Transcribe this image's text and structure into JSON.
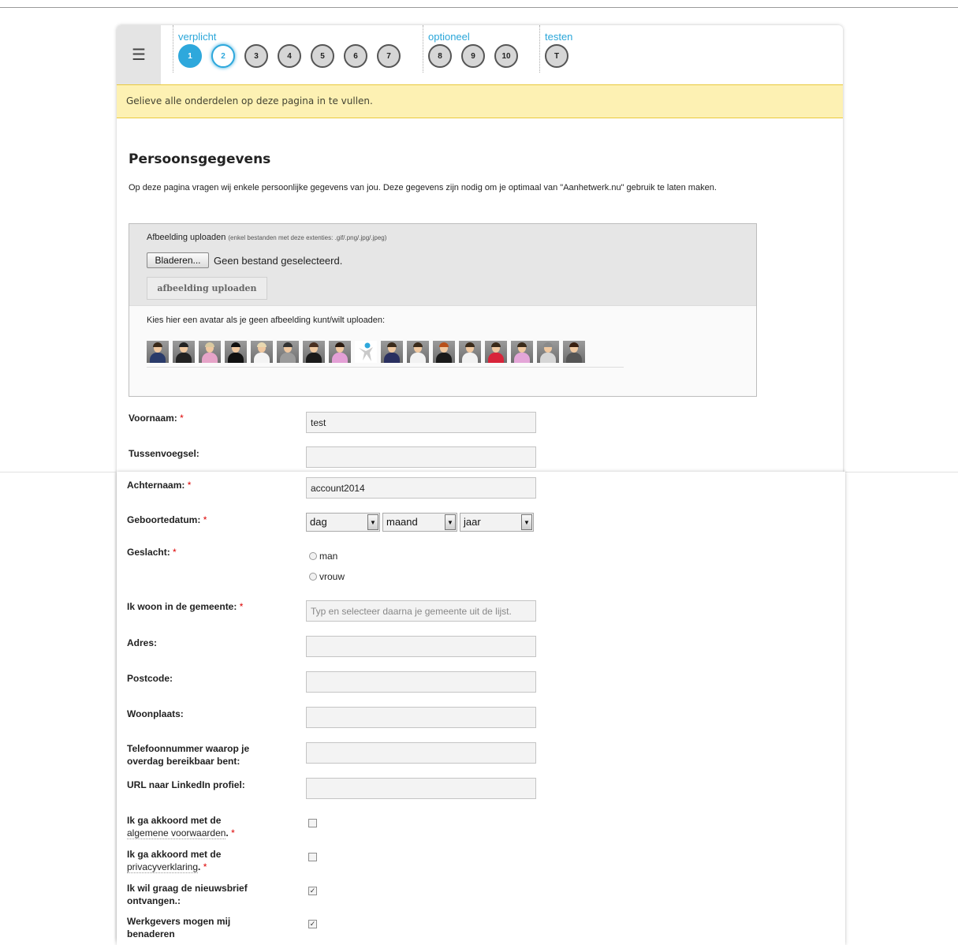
{
  "nav": {
    "menu_icon": "hamburger-menu-icon",
    "groups": [
      {
        "label": "verplicht",
        "steps": [
          {
            "label": "1",
            "state": "done"
          },
          {
            "label": "2",
            "state": "current"
          },
          {
            "label": "3",
            "state": "pending"
          },
          {
            "label": "4",
            "state": "pending"
          },
          {
            "label": "5",
            "state": "pending"
          },
          {
            "label": "6",
            "state": "pending"
          },
          {
            "label": "7",
            "state": "pending"
          }
        ]
      },
      {
        "label": "optioneel",
        "steps": [
          {
            "label": "8",
            "state": "pending"
          },
          {
            "label": "9",
            "state": "pending"
          },
          {
            "label": "10",
            "state": "pending"
          }
        ]
      },
      {
        "label": "testen",
        "steps": [
          {
            "label": "T",
            "state": "pending"
          }
        ]
      }
    ]
  },
  "notice": "Gelieve alle onderdelen op deze pagina in te vullen.",
  "page": {
    "title": "Persoonsgegevens",
    "intro": "Op deze pagina vragen wij enkele persoonlijke gegevens van jou. Deze gegevens zijn nodig om je optimaal van \"Aanhetwerk.nu\" gebruik te laten maken."
  },
  "upload": {
    "label": "Afbeelding uploaden",
    "hint": "(enkel bestanden met deze extenties: .gif/.png/.jpg/.jpeg)",
    "browse_label": "Bladeren...",
    "file_status": "Geen bestand geselecteerd.",
    "upload_button": "afbeelding uploaden",
    "avatar_prompt": "Kies hier een avatar als je geen afbeelding kunt/wilt uploaden:"
  },
  "avatars": [
    {
      "body": "#2a3b6a",
      "hair": "#3a2a1a"
    },
    {
      "body": "#222222",
      "hair": "#222222"
    },
    {
      "body": "#e6a4c8",
      "hair": "#d9c9a0"
    },
    {
      "body": "#111111",
      "hair": "#111111"
    },
    {
      "body": "#f4f4f4",
      "hair": "#e8d8b0"
    },
    {
      "body": "#9b9b9b",
      "hair": "#333333"
    },
    {
      "body": "#1a1a1a",
      "hair": "#4a3020"
    },
    {
      "body": "#e4a0d6",
      "hair": "#2a1a10"
    },
    {
      "body": "logo",
      "hair": "logo"
    },
    {
      "body": "#2a3060",
      "hair": "#3a2a1a"
    },
    {
      "body": "#f2f2f2",
      "hair": "#3a2a1a"
    },
    {
      "body": "#1a1a1a",
      "hair": "#b8501a"
    },
    {
      "body": "#f2f2f2",
      "hair": "#3a2a1a"
    },
    {
      "body": "#d8243a",
      "hair": "#3a2a1a"
    },
    {
      "body": "#e4a6d8",
      "hair": "#3a2a1a"
    },
    {
      "body": "#d6d6d6",
      "hair": "#8a8a8a"
    },
    {
      "body": "#555555",
      "hair": "#3a2010"
    }
  ],
  "form": {
    "voornaam": {
      "label": "Voornaam:",
      "value": "test"
    },
    "tussenvoegsel": {
      "label": "Tussenvoegsel:",
      "value": ""
    },
    "achternaam": {
      "label": "Achternaam:",
      "value": "account2014"
    },
    "geboortedatum": {
      "label": "Geboortedatum:",
      "day": "dag",
      "month": "maand",
      "year": "jaar"
    },
    "geslacht": {
      "label": "Geslacht:",
      "options": [
        "man",
        "vrouw"
      ]
    },
    "gemeente": {
      "label": "Ik woon in de gemeente:",
      "placeholder": "Typ en selecteer daarna je gemeente uit de lijst."
    },
    "adres": {
      "label": "Adres:",
      "value": ""
    },
    "postcode": {
      "label": "Postcode:",
      "value": ""
    },
    "woonplaats": {
      "label": "Woonplaats:",
      "value": ""
    },
    "telefoon": {
      "label": "Telefoonnummer waarop je overdag bereikbaar bent:",
      "value": ""
    },
    "linkedin": {
      "label": "URL naar LinkedIn profiel:",
      "value": ""
    },
    "voorwaarden": {
      "label": "Ik ga akkoord met de",
      "link": "algemene voorwaarden",
      "checked": false
    },
    "privacy": {
      "label": "Ik ga akkoord met de",
      "link": "privacyverklaring",
      "checked": false
    },
    "nieuwsbrief": {
      "label": "Ik wil graag de nieuwsbrief ontvangen.:",
      "checked": true
    },
    "werkgevers": {
      "label": "Werkgevers mogen mij benaderen",
      "checked": true
    }
  },
  "required_mark": "*",
  "colors": {
    "accent": "#2ea8dc",
    "notice_bg": "#fdf1b3",
    "required": "#dd0000"
  }
}
